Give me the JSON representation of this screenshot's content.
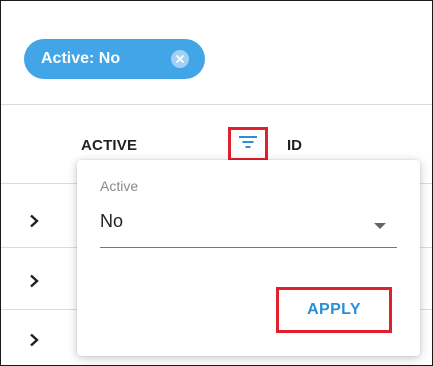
{
  "filter_chip": {
    "label": "Active: No"
  },
  "table": {
    "columns": [
      "ACTIVE",
      "ID"
    ]
  },
  "filter_popup": {
    "field_label": "Active",
    "selected_value": "No",
    "apply_label": "APPLY"
  },
  "colors": {
    "chip_bg": "#42a5e8",
    "accent_blue": "#2a8fd6",
    "highlight_red": "#e0202c"
  },
  "icons": {
    "chip_close": "close-circle-icon",
    "filter": "filter-lines-icon",
    "row_expand": "chevron-right-icon",
    "dropdown": "caret-down-icon"
  }
}
